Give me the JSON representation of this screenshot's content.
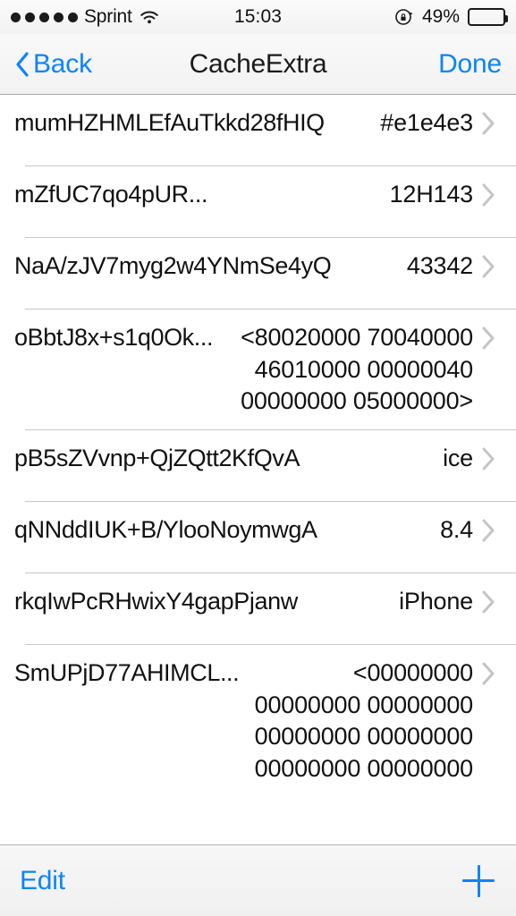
{
  "status_bar": {
    "signal_dots": 5,
    "carrier": "Sprint",
    "wifi_icon": "wifi-icon",
    "time": "15:03",
    "rotation_lock_icon": "rotation-lock-icon",
    "battery_percent": "49%",
    "battery_level": 49
  },
  "nav_bar": {
    "back_label": "Back",
    "title": "CacheExtra",
    "done_label": "Done",
    "back_icon": "chevron-left-icon"
  },
  "list": {
    "disclosure_icon": "chevron-right-icon",
    "rows": [
      {
        "key": "mumHZHMLEfAuTkkd28fHIQ",
        "value": "#e1e4e3"
      },
      {
        "key": "mZfUC7qo4pUR...",
        "value": "12H143"
      },
      {
        "key": "NaA/zJV7myg2w4YNmSe4yQ",
        "value": "43342"
      },
      {
        "key": "oBbtJ8x+s1q0Ok...",
        "value": "<80020000 70040000 46010000 00000040 00000000 05000000>"
      },
      {
        "key": "pB5sZVvnp+QjZQtt2KfQvA",
        "value": "ice"
      },
      {
        "key": "qNNddIUK+B/YlooNoymwgA",
        "value": "8.4"
      },
      {
        "key": "rkqIwPcRHwixY4gapPjanw",
        "value": "iPhone"
      },
      {
        "key": "SmUPjD77AHIMCL...",
        "value": "<00000000 00000000 00000000 00000000 00000000 00000000 00000000"
      }
    ]
  },
  "toolbar": {
    "edit_label": "Edit",
    "add_icon": "plus-icon"
  },
  "colors": {
    "accent": "#0a84ff",
    "text": "#111111",
    "separator": "#c8c7cc",
    "bar_background": "#f2f2f2"
  }
}
